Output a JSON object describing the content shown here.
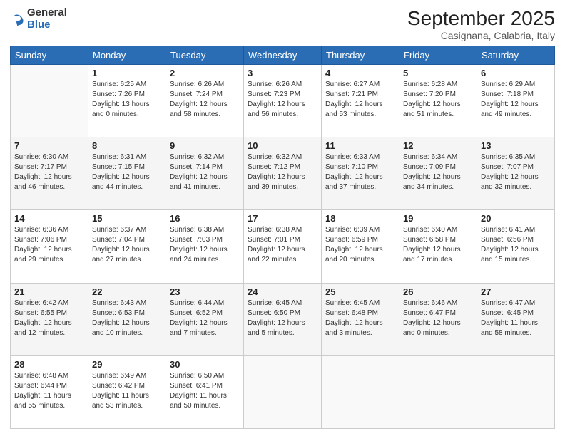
{
  "header": {
    "logo": {
      "general": "General",
      "blue": "Blue"
    },
    "title": "September 2025",
    "location": "Casignana, Calabria, Italy"
  },
  "days_of_week": [
    "Sunday",
    "Monday",
    "Tuesday",
    "Wednesday",
    "Thursday",
    "Friday",
    "Saturday"
  ],
  "weeks": [
    [
      {
        "day": "",
        "sunrise": "",
        "sunset": "",
        "daylight": ""
      },
      {
        "day": "1",
        "sunrise": "Sunrise: 6:25 AM",
        "sunset": "Sunset: 7:26 PM",
        "daylight": "Daylight: 13 hours and 0 minutes."
      },
      {
        "day": "2",
        "sunrise": "Sunrise: 6:26 AM",
        "sunset": "Sunset: 7:24 PM",
        "daylight": "Daylight: 12 hours and 58 minutes."
      },
      {
        "day": "3",
        "sunrise": "Sunrise: 6:26 AM",
        "sunset": "Sunset: 7:23 PM",
        "daylight": "Daylight: 12 hours and 56 minutes."
      },
      {
        "day": "4",
        "sunrise": "Sunrise: 6:27 AM",
        "sunset": "Sunset: 7:21 PM",
        "daylight": "Daylight: 12 hours and 53 minutes."
      },
      {
        "day": "5",
        "sunrise": "Sunrise: 6:28 AM",
        "sunset": "Sunset: 7:20 PM",
        "daylight": "Daylight: 12 hours and 51 minutes."
      },
      {
        "day": "6",
        "sunrise": "Sunrise: 6:29 AM",
        "sunset": "Sunset: 7:18 PM",
        "daylight": "Daylight: 12 hours and 49 minutes."
      }
    ],
    [
      {
        "day": "7",
        "sunrise": "Sunrise: 6:30 AM",
        "sunset": "Sunset: 7:17 PM",
        "daylight": "Daylight: 12 hours and 46 minutes."
      },
      {
        "day": "8",
        "sunrise": "Sunrise: 6:31 AM",
        "sunset": "Sunset: 7:15 PM",
        "daylight": "Daylight: 12 hours and 44 minutes."
      },
      {
        "day": "9",
        "sunrise": "Sunrise: 6:32 AM",
        "sunset": "Sunset: 7:14 PM",
        "daylight": "Daylight: 12 hours and 41 minutes."
      },
      {
        "day": "10",
        "sunrise": "Sunrise: 6:32 AM",
        "sunset": "Sunset: 7:12 PM",
        "daylight": "Daylight: 12 hours and 39 minutes."
      },
      {
        "day": "11",
        "sunrise": "Sunrise: 6:33 AM",
        "sunset": "Sunset: 7:10 PM",
        "daylight": "Daylight: 12 hours and 37 minutes."
      },
      {
        "day": "12",
        "sunrise": "Sunrise: 6:34 AM",
        "sunset": "Sunset: 7:09 PM",
        "daylight": "Daylight: 12 hours and 34 minutes."
      },
      {
        "day": "13",
        "sunrise": "Sunrise: 6:35 AM",
        "sunset": "Sunset: 7:07 PM",
        "daylight": "Daylight: 12 hours and 32 minutes."
      }
    ],
    [
      {
        "day": "14",
        "sunrise": "Sunrise: 6:36 AM",
        "sunset": "Sunset: 7:06 PM",
        "daylight": "Daylight: 12 hours and 29 minutes."
      },
      {
        "day": "15",
        "sunrise": "Sunrise: 6:37 AM",
        "sunset": "Sunset: 7:04 PM",
        "daylight": "Daylight: 12 hours and 27 minutes."
      },
      {
        "day": "16",
        "sunrise": "Sunrise: 6:38 AM",
        "sunset": "Sunset: 7:03 PM",
        "daylight": "Daylight: 12 hours and 24 minutes."
      },
      {
        "day": "17",
        "sunrise": "Sunrise: 6:38 AM",
        "sunset": "Sunset: 7:01 PM",
        "daylight": "Daylight: 12 hours and 22 minutes."
      },
      {
        "day": "18",
        "sunrise": "Sunrise: 6:39 AM",
        "sunset": "Sunset: 6:59 PM",
        "daylight": "Daylight: 12 hours and 20 minutes."
      },
      {
        "day": "19",
        "sunrise": "Sunrise: 6:40 AM",
        "sunset": "Sunset: 6:58 PM",
        "daylight": "Daylight: 12 hours and 17 minutes."
      },
      {
        "day": "20",
        "sunrise": "Sunrise: 6:41 AM",
        "sunset": "Sunset: 6:56 PM",
        "daylight": "Daylight: 12 hours and 15 minutes."
      }
    ],
    [
      {
        "day": "21",
        "sunrise": "Sunrise: 6:42 AM",
        "sunset": "Sunset: 6:55 PM",
        "daylight": "Daylight: 12 hours and 12 minutes."
      },
      {
        "day": "22",
        "sunrise": "Sunrise: 6:43 AM",
        "sunset": "Sunset: 6:53 PM",
        "daylight": "Daylight: 12 hours and 10 minutes."
      },
      {
        "day": "23",
        "sunrise": "Sunrise: 6:44 AM",
        "sunset": "Sunset: 6:52 PM",
        "daylight": "Daylight: 12 hours and 7 minutes."
      },
      {
        "day": "24",
        "sunrise": "Sunrise: 6:45 AM",
        "sunset": "Sunset: 6:50 PM",
        "daylight": "Daylight: 12 hours and 5 minutes."
      },
      {
        "day": "25",
        "sunrise": "Sunrise: 6:45 AM",
        "sunset": "Sunset: 6:48 PM",
        "daylight": "Daylight: 12 hours and 3 minutes."
      },
      {
        "day": "26",
        "sunrise": "Sunrise: 6:46 AM",
        "sunset": "Sunset: 6:47 PM",
        "daylight": "Daylight: 12 hours and 0 minutes."
      },
      {
        "day": "27",
        "sunrise": "Sunrise: 6:47 AM",
        "sunset": "Sunset: 6:45 PM",
        "daylight": "Daylight: 11 hours and 58 minutes."
      }
    ],
    [
      {
        "day": "28",
        "sunrise": "Sunrise: 6:48 AM",
        "sunset": "Sunset: 6:44 PM",
        "daylight": "Daylight: 11 hours and 55 minutes."
      },
      {
        "day": "29",
        "sunrise": "Sunrise: 6:49 AM",
        "sunset": "Sunset: 6:42 PM",
        "daylight": "Daylight: 11 hours and 53 minutes."
      },
      {
        "day": "30",
        "sunrise": "Sunrise: 6:50 AM",
        "sunset": "Sunset: 6:41 PM",
        "daylight": "Daylight: 11 hours and 50 minutes."
      },
      {
        "day": "",
        "sunrise": "",
        "sunset": "",
        "daylight": ""
      },
      {
        "day": "",
        "sunrise": "",
        "sunset": "",
        "daylight": ""
      },
      {
        "day": "",
        "sunrise": "",
        "sunset": "",
        "daylight": ""
      },
      {
        "day": "",
        "sunrise": "",
        "sunset": "",
        "daylight": ""
      }
    ]
  ]
}
